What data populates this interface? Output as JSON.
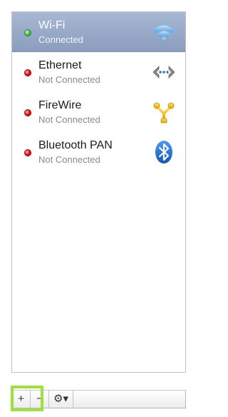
{
  "services": [
    {
      "name": "Wi-Fi",
      "status": "Connected",
      "status_indicator": "green-dot",
      "icon": "wifi-icon",
      "selected": true
    },
    {
      "name": "Ethernet",
      "status": "Not Connected",
      "status_indicator": "red-dot",
      "icon": "ethernet-icon",
      "selected": false
    },
    {
      "name": "FireWire",
      "status": "Not Connected",
      "status_indicator": "red-dot",
      "icon": "firewire-icon",
      "selected": false
    },
    {
      "name": "Bluetooth PAN",
      "status": "Not Connected",
      "status_indicator": "red-dot",
      "icon": "bluetooth-icon",
      "selected": false
    }
  ],
  "toolbar": {
    "add_label": "+",
    "remove_label": "−",
    "action_label": "⚙▾",
    "action_icon": "gear-icon",
    "highlighted_button": "add"
  },
  "colors": {
    "selection": "#8fa3c4",
    "connected": "#3cb83c",
    "not_connected": "#d81414",
    "highlight": "#9ee03c",
    "bluetooth": "#1c6fd6",
    "firewire": "#f2c21a"
  }
}
